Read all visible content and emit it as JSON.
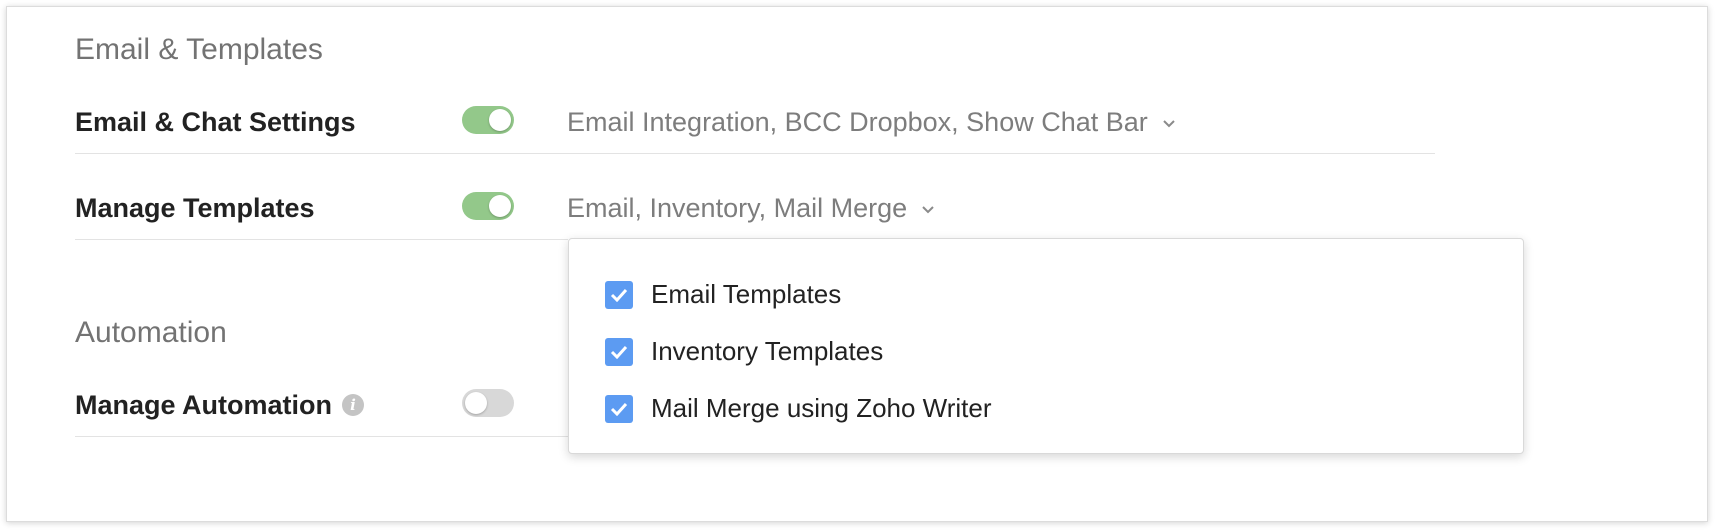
{
  "sections": {
    "email": {
      "title": "Email & Templates",
      "rows": [
        {
          "label": "Email & Chat Settings",
          "enabled": true,
          "summary": "Email Integration, BCC Dropbox, Show Chat Bar"
        },
        {
          "label": "Manage Templates",
          "enabled": true,
          "summary": "Email, Inventory, Mail Merge"
        }
      ]
    },
    "automation": {
      "title": "Automation",
      "rows": [
        {
          "label": "Manage Automation",
          "enabled": false,
          "info_icon": "info-icon"
        }
      ]
    }
  },
  "templates_dropdown": {
    "options": [
      {
        "label": "Email Templates",
        "checked": true
      },
      {
        "label": "Inventory Templates",
        "checked": true
      },
      {
        "label": "Mail Merge using Zoho Writer",
        "checked": true
      }
    ]
  },
  "colors": {
    "toggle_on": "#93c88a",
    "toggle_off": "#d8d8d8",
    "checkbox": "#5c9bf2"
  }
}
